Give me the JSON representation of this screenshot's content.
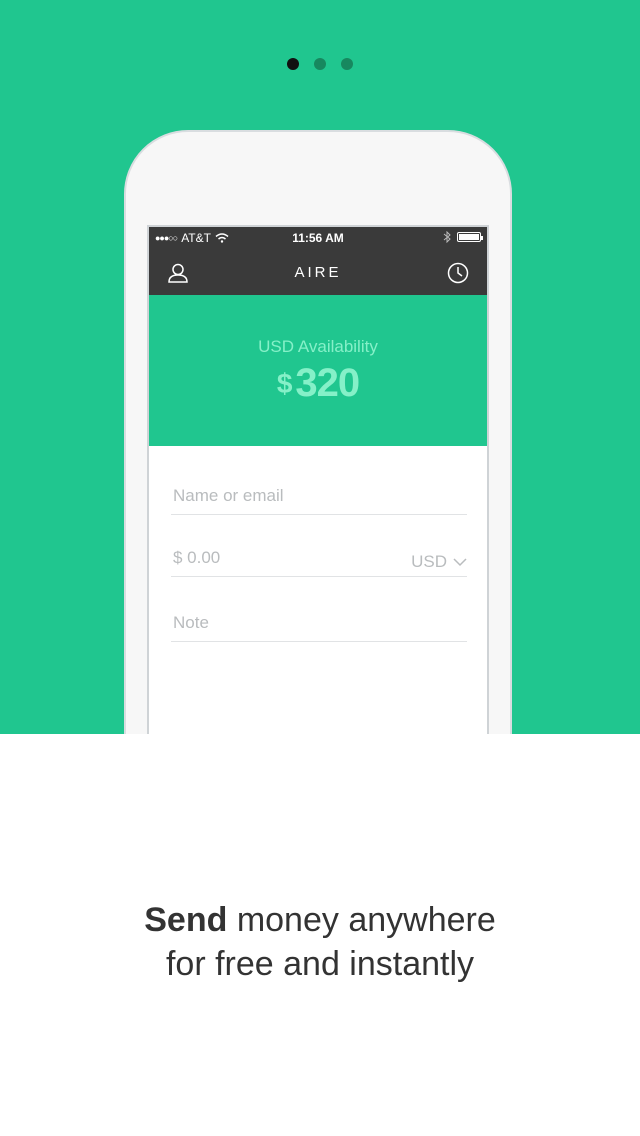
{
  "pager": {
    "count": 3,
    "active": 0
  },
  "status": {
    "carrier": "AT&T",
    "time": "11:56 AM"
  },
  "nav": {
    "title": "AIRE",
    "left_icon": "user-icon",
    "right_icon": "clock-icon"
  },
  "balance": {
    "label": "USD Availability",
    "currency_symbol": "$",
    "amount": "320"
  },
  "form": {
    "name_placeholder": "Name or email",
    "amount_placeholder": "$ 0.00",
    "currency": "USD",
    "note_placeholder": "Note"
  },
  "tagline": {
    "bold": "Send",
    "line1_rest": " money anywhere",
    "line2": "for free and instantly"
  },
  "colors": {
    "brand_green": "#20c68f",
    "balance_text": "#85f0c8",
    "nav_dark": "#3a3a3a"
  }
}
